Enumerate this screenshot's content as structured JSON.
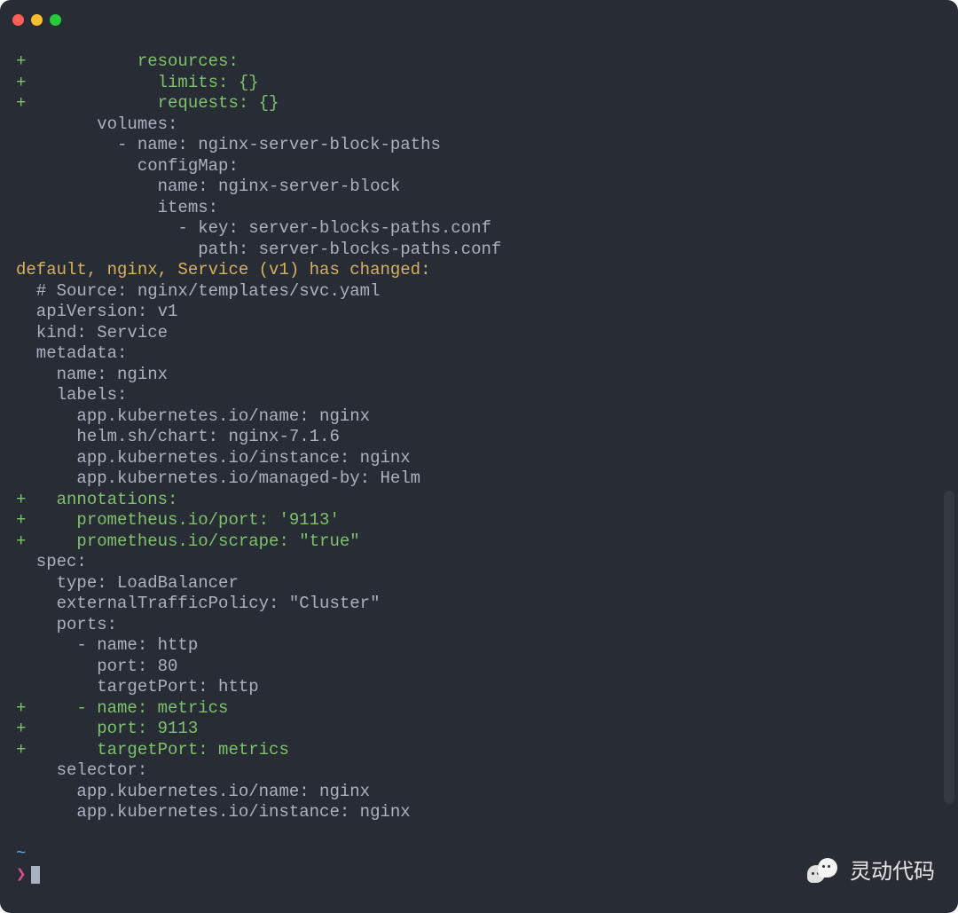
{
  "window": {
    "dots": [
      "red",
      "yellow",
      "green"
    ]
  },
  "lines": [
    {
      "cls": "g",
      "text": "+           resources:"
    },
    {
      "cls": "g",
      "text": "+             limits: {}"
    },
    {
      "cls": "g",
      "text": "+             requests: {}"
    },
    {
      "cls": "",
      "text": "        volumes:"
    },
    {
      "cls": "",
      "text": "          - name: nginx-server-block-paths"
    },
    {
      "cls": "",
      "text": "            configMap:"
    },
    {
      "cls": "",
      "text": "              name: nginx-server-block"
    },
    {
      "cls": "",
      "text": "              items:"
    },
    {
      "cls": "",
      "text": "                - key: server-blocks-paths.conf"
    },
    {
      "cls": "",
      "text": "                  path: server-blocks-paths.conf"
    },
    {
      "cls": "y",
      "text": "default, nginx, Service (v1) has changed:"
    },
    {
      "cls": "",
      "text": "  # Source: nginx/templates/svc.yaml"
    },
    {
      "cls": "",
      "text": "  apiVersion: v1"
    },
    {
      "cls": "",
      "text": "  kind: Service"
    },
    {
      "cls": "",
      "text": "  metadata:"
    },
    {
      "cls": "",
      "text": "    name: nginx"
    },
    {
      "cls": "",
      "text": "    labels:"
    },
    {
      "cls": "",
      "text": "      app.kubernetes.io/name: nginx"
    },
    {
      "cls": "",
      "text": "      helm.sh/chart: nginx-7.1.6"
    },
    {
      "cls": "",
      "text": "      app.kubernetes.io/instance: nginx"
    },
    {
      "cls": "",
      "text": "      app.kubernetes.io/managed-by: Helm"
    },
    {
      "cls": "g",
      "text": "+   annotations:"
    },
    {
      "cls": "g",
      "text": "+     prometheus.io/port: '9113'"
    },
    {
      "cls": "g",
      "text": "+     prometheus.io/scrape: \"true\""
    },
    {
      "cls": "",
      "text": "  spec:"
    },
    {
      "cls": "",
      "text": "    type: LoadBalancer"
    },
    {
      "cls": "",
      "text": "    externalTrafficPolicy: \"Cluster\""
    },
    {
      "cls": "",
      "text": "    ports:"
    },
    {
      "cls": "",
      "text": "      - name: http"
    },
    {
      "cls": "",
      "text": "        port: 80"
    },
    {
      "cls": "",
      "text": "        targetPort: http"
    },
    {
      "cls": "g",
      "text": "+     - name: metrics"
    },
    {
      "cls": "g",
      "text": "+       port: 9113"
    },
    {
      "cls": "g",
      "text": "+       targetPort: metrics"
    },
    {
      "cls": "",
      "text": "    selector:"
    },
    {
      "cls": "",
      "text": "      app.kubernetes.io/name: nginx"
    },
    {
      "cls": "",
      "text": "      app.kubernetes.io/instance: nginx"
    },
    {
      "cls": "",
      "text": ""
    },
    {
      "cls": "bl",
      "text": "~"
    }
  ],
  "prompt": {
    "symbol": "❯"
  },
  "watermark": {
    "text": "灵动代码"
  }
}
